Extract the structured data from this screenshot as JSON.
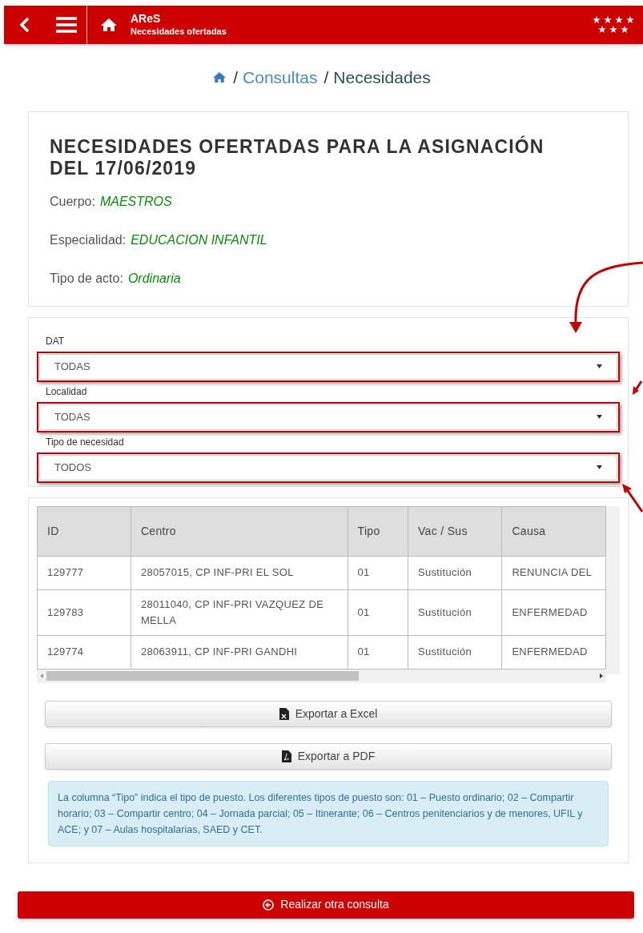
{
  "header": {
    "app_name": "AReS",
    "subtitle": "Necesidades ofertadas"
  },
  "breadcrumb": [
    {
      "separator": "/",
      "label": "Consultas",
      "kind": "link"
    },
    {
      "separator": "/",
      "label": "Necesidades",
      "kind": "current"
    }
  ],
  "summary": {
    "title": "NECESIDADES OFERTADAS PARA LA ASIGNACIÓN DEL 17/06/2019",
    "fields": [
      {
        "label": "Cuerpo:",
        "value": "MAESTROS"
      },
      {
        "label": "Especialidad:",
        "value": "EDUCACION INFANTIL"
      },
      {
        "label": "Tipo de acto:",
        "value": "Ordinaria"
      }
    ]
  },
  "filters": [
    {
      "label": "DAT",
      "value": "TODAS",
      "highlighted": true
    },
    {
      "label": "Localidad",
      "value": "TODAS",
      "highlighted": true
    },
    {
      "label": "Tipo de necesidad",
      "value": "TODOS",
      "highlighted": true
    }
  ],
  "table": {
    "columns": [
      "ID",
      "Centro",
      "Tipo",
      "Vac / Sus",
      "Causa"
    ],
    "rows": [
      [
        "129777",
        "28057015, CP INF-PRI EL SOL",
        "01",
        "Sustitución",
        "RENUNCIA DEL"
      ],
      [
        "129783",
        "28011040, CP INF-PRI VAZQUEZ DE MELLA",
        "01",
        "Sustitución",
        "ENFERMEDAD"
      ],
      [
        "129774",
        "28063911, CP INF-PRI GANDHI",
        "01",
        "Sustitución",
        "ENFERMEDAD"
      ]
    ]
  },
  "export_buttons": [
    {
      "label": "Exportar a Excel",
      "kind": "excel"
    },
    {
      "label": "Exportar a PDF",
      "kind": "pdf"
    }
  ],
  "info_note": "La columna “Tipo” indica el tipo de puesto. Los diferentes tipos de puesto son: 01 – Puesto ordinario; 02 – Compartir horario; 03 – Compartir centro; 04 – Jornada parcial; 05 – Itinerante; 06 – Centros penitenciarios y de menores, UFIL y ACE; y 07 – Aulas hospitalarias, SAED y CET.",
  "action_button": "Realizar otra consulta"
}
